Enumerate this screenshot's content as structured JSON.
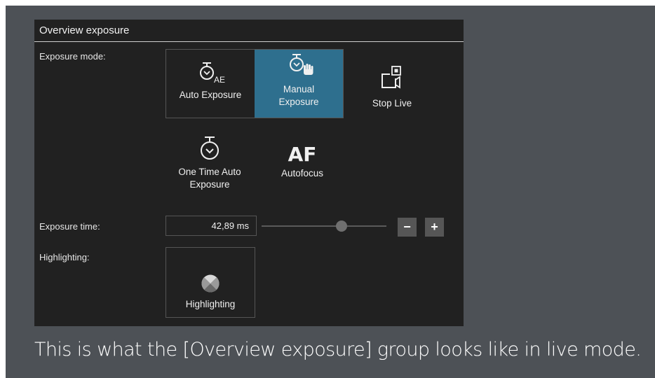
{
  "panel": {
    "title": "Overview exposure",
    "exposure_mode_label": "Exposure mode:",
    "exposure_time_label": "Exposure time:",
    "highlighting_label": "Highlighting:"
  },
  "buttons": {
    "auto_exposure": {
      "label": "Auto Exposure",
      "icon_sub": "AE",
      "icon": "stopwatch-icon"
    },
    "manual_exposure": {
      "label_line1": "Manual",
      "label_line2": "Exposure",
      "icon": "stopwatch-hand-icon",
      "active": true
    },
    "stop_live": {
      "label": "Stop Live",
      "icon": "camera-icon"
    },
    "one_time_auto": {
      "label_line1": "One Time Auto",
      "label_line2": "Exposure",
      "icon": "stopwatch-icon"
    },
    "autofocus": {
      "label": "Autofocus",
      "icon_text": "AF"
    },
    "highlighting": {
      "label": "Highlighting",
      "icon": "highlight-icon"
    }
  },
  "exposure_time": {
    "value": "42,89 ms",
    "slider_position": 0.64,
    "minus_label": "−",
    "plus_label": "+"
  },
  "caption": "This is what the [Overview exposure] group looks like in live mode.",
  "colors": {
    "background": "#4d5156",
    "panel": "#212121",
    "active": "#2e6f8e"
  }
}
